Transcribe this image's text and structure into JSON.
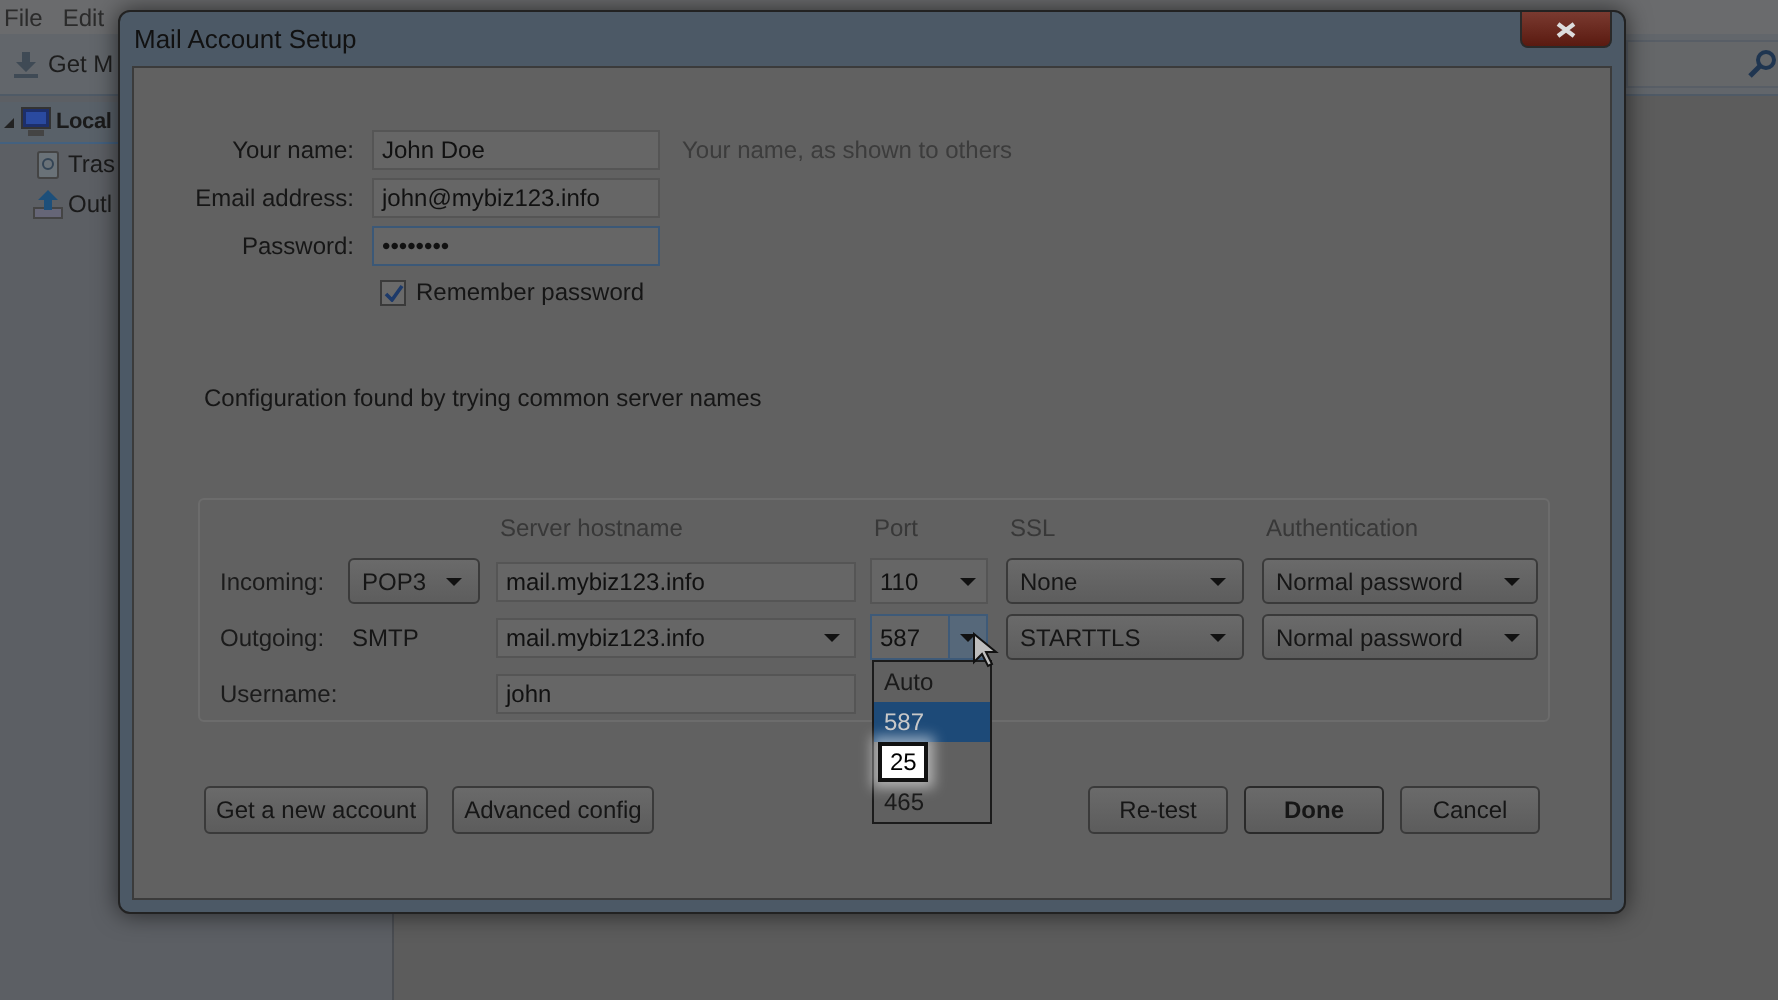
{
  "app": {
    "menu": [
      "File",
      "Edit"
    ],
    "toolbar_button": "Get M",
    "folders": [
      {
        "label": "Local",
        "kind": "computer",
        "selected": true,
        "expanded": true,
        "children": [
          {
            "label": "Tras",
            "kind": "trash",
            "selected": false
          },
          {
            "label": "Outl",
            "kind": "outbox",
            "selected": false
          }
        ]
      }
    ]
  },
  "dialog": {
    "title": "Mail Account Setup",
    "identity": [
      {
        "label": "Your name:",
        "value": "John Doe",
        "focused": false,
        "hint": "Your name, as shown to others"
      },
      {
        "label": "Email address:",
        "value": "john@mybiz123.info",
        "focused": false
      },
      {
        "label": "Password:",
        "value": "••••••••",
        "focused": true
      }
    ],
    "remember_password": {
      "label": "Remember password",
      "checked": true
    },
    "status": "Configuration found by trying common server names",
    "server": {
      "columns": [
        "Server hostname",
        "Port",
        "SSL",
        "Authentication"
      ],
      "rows": [
        {
          "label": "Incoming:",
          "protocol": {
            "kind": "select",
            "label": "POP3"
          },
          "host": {
            "kind": "field",
            "value": "mail.mybiz123.info"
          },
          "port": "110",
          "port_open": false,
          "ssl": "None",
          "auth": "Normal password"
        },
        {
          "label": "Outgoing:",
          "protocol": {
            "kind": "text",
            "label": "SMTP"
          },
          "host": {
            "kind": "combo",
            "value": "mail.mybiz123.info"
          },
          "port": "587",
          "port_open": true,
          "ssl": "STARTTLS",
          "auth": "Normal password"
        }
      ],
      "username": {
        "label": "Username:",
        "value": "john"
      },
      "port_options": [
        {
          "label": "Auto",
          "selected": false,
          "highlighted": false
        },
        {
          "label": "587",
          "selected": true,
          "highlighted": false
        },
        {
          "label": "25",
          "selected": false,
          "highlighted": true
        },
        {
          "label": "465",
          "selected": false,
          "highlighted": false
        }
      ]
    },
    "buttons_left": [
      {
        "label": "Get a new account",
        "default": false
      },
      {
        "label": "Advanced config",
        "default": false
      }
    ],
    "buttons_right": [
      {
        "label": "Re-test",
        "default": false
      },
      {
        "label": "Done",
        "default": true
      },
      {
        "label": "Cancel",
        "default": false
      }
    ]
  }
}
